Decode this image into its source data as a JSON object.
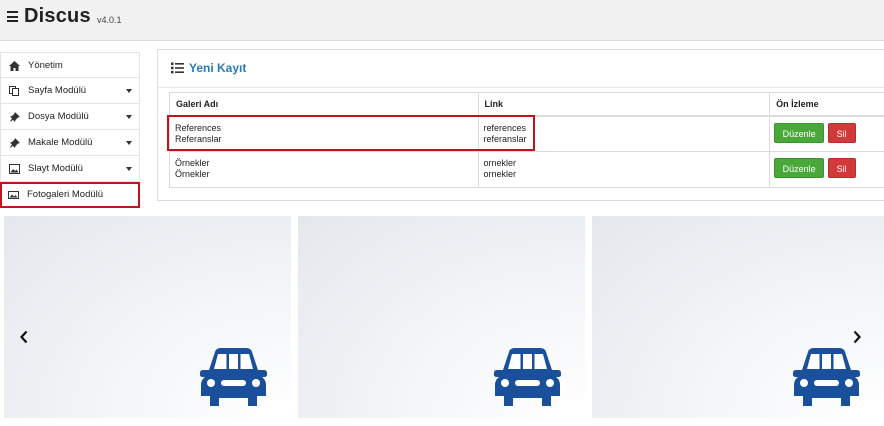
{
  "header": {
    "brand": "Discus",
    "version": "v4.0.1",
    "menu_icon": "hamburger-icon"
  },
  "sidebar": {
    "items": [
      {
        "label": "Yönetim",
        "icon": "home-icon",
        "has_caret": false
      },
      {
        "label": "Sayfa Modülü",
        "icon": "pages-icon",
        "has_caret": true
      },
      {
        "label": "Dosya Modülü",
        "icon": "pin-icon",
        "has_caret": true
      },
      {
        "label": "Makale Modülü",
        "icon": "pin-icon",
        "has_caret": true
      },
      {
        "label": "Slayt Modülü",
        "icon": "picture-icon",
        "has_caret": true
      },
      {
        "label": "Fotogaleri Modülü",
        "icon": "image-icon",
        "has_caret": false,
        "active": true
      }
    ]
  },
  "panel": {
    "title": "Yeni Kayıt",
    "title_icon": "list-icon",
    "columns": [
      "Galeri Adı",
      "Link",
      "Ön İzleme"
    ],
    "rows": [
      {
        "name_line1": "References",
        "name_line2": "Referanslar",
        "link_line1": "references",
        "link_line2": "referanslar",
        "edit": "Düzenle",
        "delete": "Sil"
      },
      {
        "name_line1": "Örnekler",
        "name_line2": "Örnekler",
        "link_line1": "ornekler",
        "link_line2": "ornekler",
        "edit": "Düzenle",
        "delete": "Sil"
      }
    ]
  },
  "gallery": {
    "slides": [
      {
        "image": "car-icon"
      },
      {
        "image": "car-icon"
      },
      {
        "image": "car-icon"
      }
    ],
    "prev_icon": "chevron-left-icon",
    "next_icon": "chevron-right-icon"
  },
  "colors": {
    "title_blue": "#2a7ab8",
    "edit_green": "#4aa83b",
    "delete_red": "#d23a3a",
    "highlight_red": "#c0141d",
    "car_blue": "#1a4f9c"
  }
}
